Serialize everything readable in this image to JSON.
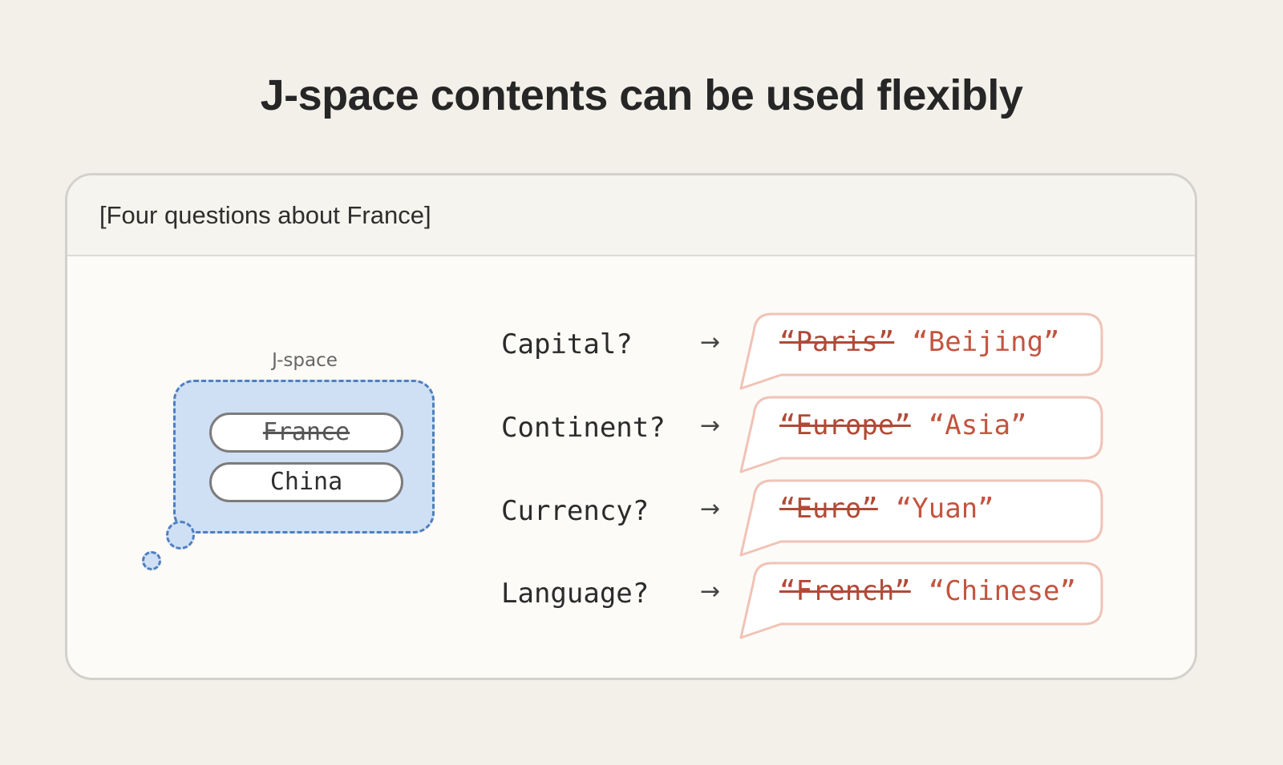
{
  "title": "J-space contents can be used flexibly",
  "panel": {
    "header": "[Four questions about France]"
  },
  "jspace": {
    "label": "J-space",
    "items": [
      {
        "text": "France",
        "struck": true
      },
      {
        "text": "China",
        "struck": false
      }
    ]
  },
  "rows": [
    {
      "question": "Capital?",
      "arrow": "→",
      "old_answer": "“Paris”",
      "new_answer": "“Beijing”"
    },
    {
      "question": "Continent?",
      "arrow": "→",
      "old_answer": "“Europe”",
      "new_answer": "“Asia”"
    },
    {
      "question": "Currency?",
      "arrow": "→",
      "old_answer": "“Euro”",
      "new_answer": "“Yuan”"
    },
    {
      "question": "Language?",
      "arrow": "→",
      "old_answer": "“French”",
      "new_answer": "“Chinese”"
    }
  ],
  "colors": {
    "background": "#f3f0e9",
    "jspace_fill": "#cfdff4",
    "jspace_border": "#4f7fbe",
    "answer_text": "#c3543f",
    "speech_border": "#f0c3b6"
  }
}
